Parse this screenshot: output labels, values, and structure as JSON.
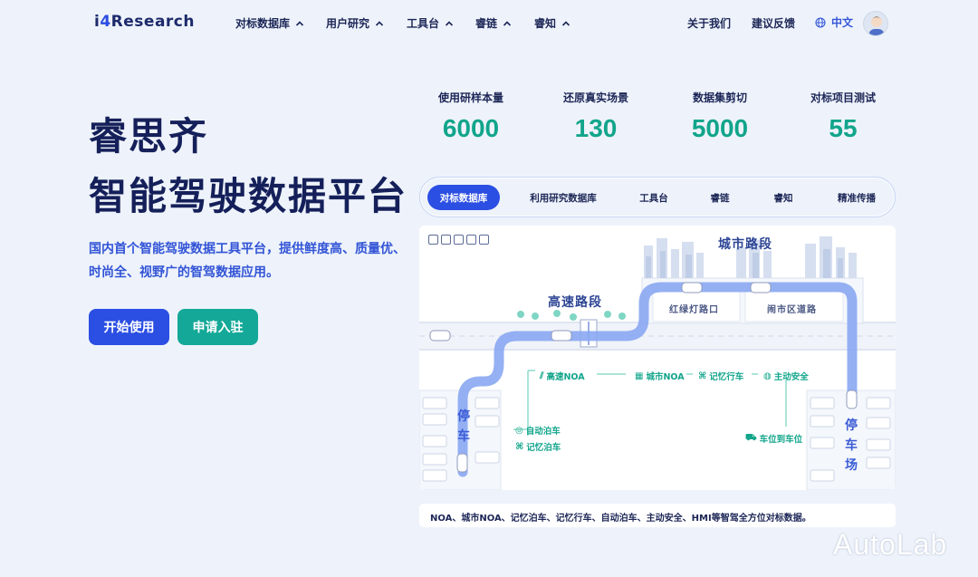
{
  "nav": {
    "logo_prefix": "i",
    "logo_four": "4",
    "logo_rest": "Research",
    "items": [
      {
        "label": "对标数据库"
      },
      {
        "label": "用户研究"
      },
      {
        "label": "工具台"
      },
      {
        "label": "睿链"
      },
      {
        "label": "睿知"
      }
    ],
    "about": "关于我们",
    "feedback": "建议反馈",
    "language": "中文"
  },
  "hero": {
    "title_line1": "睿思齐",
    "title_line2": "智能驾驶数据平台",
    "description": "国内首个智能驾驶数据工具平台，提供鲜度高、质量优、时尚全、视野广的智驾数据应用。",
    "start_button": "开始使用",
    "apply_button": "申请入驻"
  },
  "stats": [
    {
      "label": "使用研样本量",
      "value": "6000"
    },
    {
      "label": "还原真实场景",
      "value": "130"
    },
    {
      "label": "数据集剪切",
      "value": "5000"
    },
    {
      "label": "对标项目测试",
      "value": "55"
    }
  ],
  "tabs": [
    {
      "label": "对标数据库",
      "active": true
    },
    {
      "label": "利用研究数据库",
      "active": false
    },
    {
      "label": "工具台",
      "active": false
    },
    {
      "label": "睿链",
      "active": false
    },
    {
      "label": "睿知",
      "active": false
    },
    {
      "label": "精准传播",
      "active": false
    }
  ],
  "map": {
    "city_road": "城市路段",
    "highway": "高速路段",
    "traffic_light": "红绿灯路口",
    "downtown": "闹市区道路",
    "parking_left": "停车",
    "parking_right": "停车场",
    "flow": {
      "highway_noa": "高速NOA",
      "city_noa": "城市NOA",
      "memory_drive": "记忆行车",
      "active_safety": "主动安全",
      "auto_park": "自动泊车",
      "memory_park": "记忆泊车",
      "spot_to_spot": "车位到车位"
    }
  },
  "caption": "NOA、城市NOA、记忆泊车、记忆行车、自动泊车、主动安全、HMI等智驾全方位对标数据。",
  "watermark": "AutoLab",
  "colors": {
    "primary": "#2b4ee3",
    "teal": "#14a898",
    "stat_green": "#12a58b",
    "background": "#eef3fb",
    "route": "#7b9cf0"
  }
}
